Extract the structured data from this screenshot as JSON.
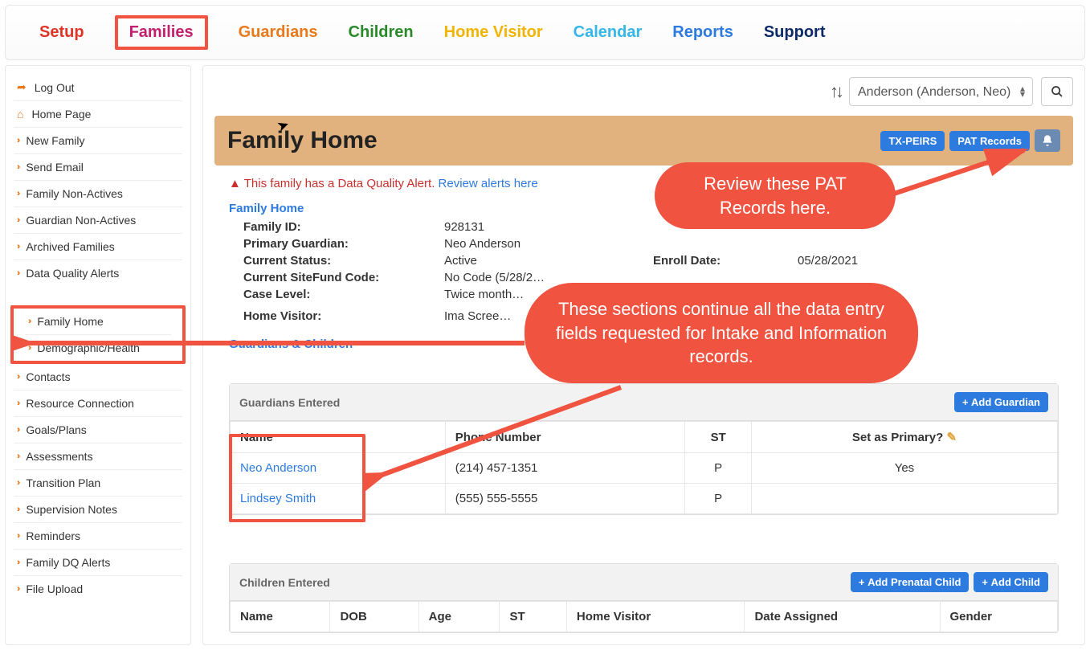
{
  "nav": {
    "setup": "Setup",
    "families": "Families",
    "guardians": "Guardians",
    "children": "Children",
    "home_visitor": "Home Visitor",
    "calendar": "Calendar",
    "reports": "Reports",
    "support": "Support"
  },
  "sidebar_top": [
    "Log Out",
    "Home Page",
    "New Family",
    "Send Email",
    "Family Non-Actives",
    "Guardian Non-Actives",
    "Archived Families",
    "Data Quality Alerts"
  ],
  "sidebar_mid": [
    "Family Home",
    "Demographic/Health"
  ],
  "sidebar_bottom": [
    "Contacts",
    "Resource Connection",
    "Goals/Plans",
    "Assessments",
    "Transition Plan",
    "Supervision Notes",
    "Reminders",
    "Family DQ Alerts",
    "File Upload"
  ],
  "family_selector": "Anderson (Anderson, Neo)",
  "header": {
    "title": "Family Home",
    "btn_txpeirs": "TX-PEIRS",
    "btn_pat": "PAT Records"
  },
  "alert": {
    "text": "This family has a Data Quality Alert.",
    "link": "Review alerts here"
  },
  "section_family_home": "Family Home",
  "info": {
    "family_id_label": "Family ID:",
    "family_id": "928131",
    "primary_guardian_label": "Primary Guardian:",
    "primary_guardian": "Neo Anderson",
    "status_label": "Current Status:",
    "status": "Active",
    "enroll_label": "Enroll Date:",
    "enroll": "05/28/2021",
    "sitefund_label": "Current SiteFund Code:",
    "sitefund": "No Code (5/28/2…",
    "case_level_label": "Case Level:",
    "case_level": "Twice month…",
    "hv_label": "Home Visitor:",
    "hv": "Ima Scree…"
  },
  "section_guardians": "Guardians & Children",
  "guardians_panel": {
    "title": "Guardians Entered",
    "btn_add": "Add Guardian",
    "cols": {
      "name": "Name",
      "phone": "Phone Number",
      "st": "ST",
      "primary": "Set as Primary?"
    },
    "rows": [
      {
        "name": "Neo Anderson",
        "phone": "(214) 457-1351",
        "st": "P",
        "primary": "Yes"
      },
      {
        "name": "Lindsey Smith",
        "phone": "(555) 555-5555",
        "st": "P",
        "primary": ""
      }
    ]
  },
  "children_panel": {
    "title": "Children Entered",
    "btn_prenatal": "Add Prenatal Child",
    "btn_add": "Add Child",
    "cols": {
      "name": "Name",
      "dob": "DOB",
      "age": "Age",
      "st": "ST",
      "hv": "Home Visitor",
      "assigned": "Date Assigned",
      "gender": "Gender"
    }
  },
  "callouts": {
    "top": "Review these PAT Records here.",
    "mid": "These sections continue all the data entry fields requested for Intake and Information records."
  }
}
